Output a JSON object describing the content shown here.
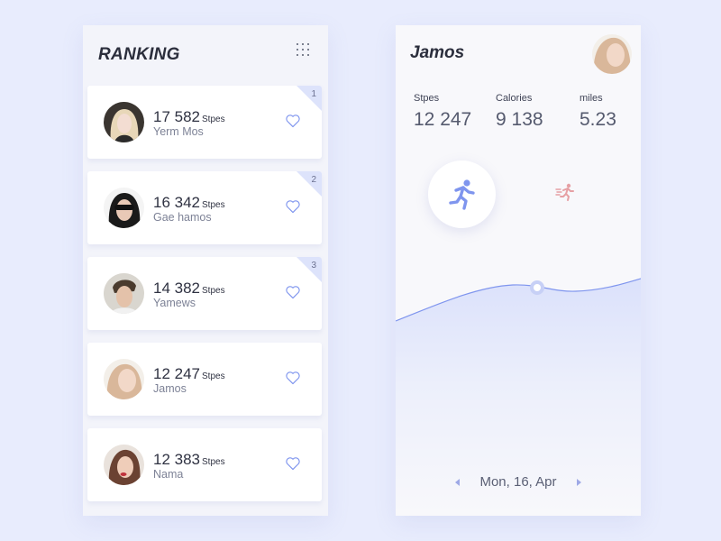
{
  "ranking": {
    "title": "RANKING",
    "menu_icon": "grid-dots-icon",
    "unit_label": "Stpes",
    "entries": [
      {
        "rank": "1",
        "steps": "17 582",
        "name": "Yerm Mos"
      },
      {
        "rank": "2",
        "steps": "16 342",
        "name": "Gae hamos"
      },
      {
        "rank": "3",
        "steps": "14 382",
        "name": "Yamews"
      },
      {
        "rank": "",
        "steps": "12 247",
        "name": "Jamos"
      },
      {
        "rank": "",
        "steps": "12 383",
        "name": "Nama"
      }
    ]
  },
  "profile": {
    "name": "Jamos",
    "stats": [
      {
        "label": "Stpes",
        "value": "12 247"
      },
      {
        "label": "Calories",
        "value": "9 138"
      },
      {
        "label": "miles",
        "value": "5.23"
      }
    ],
    "date": "Mon, 16, Apr"
  },
  "colors": {
    "accent": "#7f95ee",
    "accent_light": "#dde3fb",
    "sprint": "#e6a0a4",
    "background": "#e8ecfd"
  }
}
